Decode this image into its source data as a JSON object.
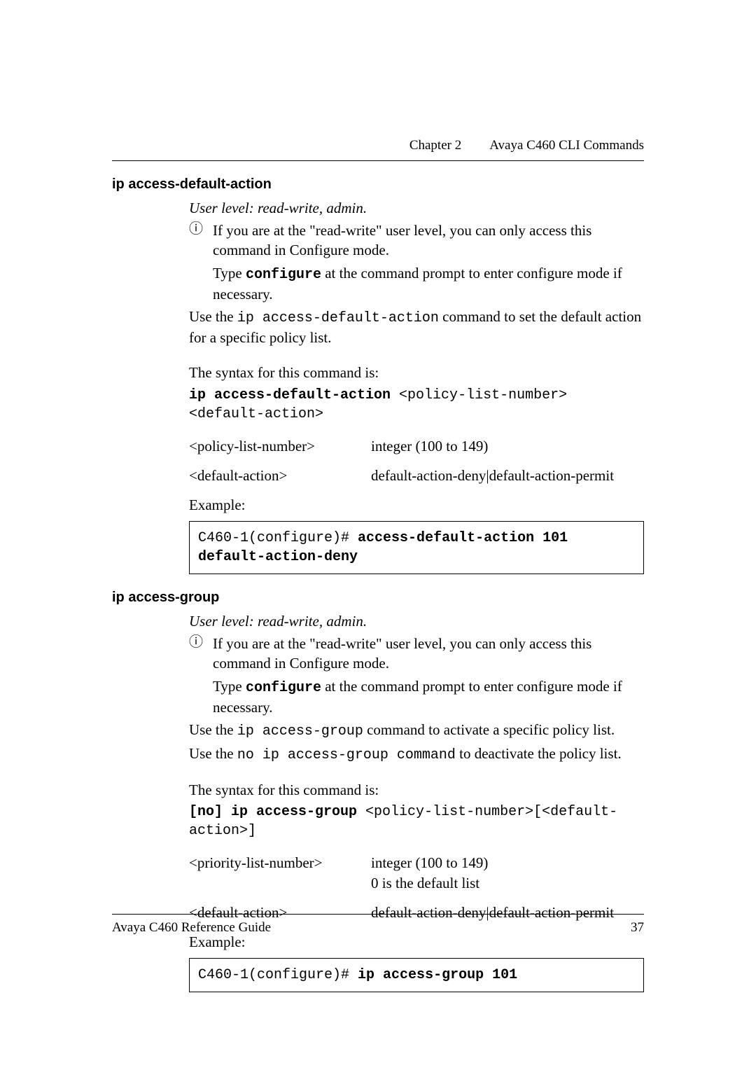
{
  "header": {
    "chapter": "Chapter 2",
    "title": "Avaya C460 CLI Commands"
  },
  "sections": [
    {
      "heading": "ip access-default-action",
      "user_level": "User level: read-write, admin.",
      "note": "If you are at the \"read-write\" user level, you can only access this command in Configure mode.",
      "note_line2_pre": "Type ",
      "note_line2_code": "configure",
      "note_line2_post": " at the command prompt to enter configure mode if necessary.",
      "desc_pre": "Use the ",
      "desc_code": "ip access-default-action",
      "desc_post": " command to set the default action for a specific policy list.",
      "syntax_label": "The syntax for this command is:",
      "syntax_cmd": "ip access-default-action",
      "syntax_args": " <policy-list-number> <default-action>",
      "params": [
        {
          "key": "<policy-list-number>",
          "val": "integer (100 to 149)"
        },
        {
          "key": "<default-action>",
          "val": "default-action-deny|default-action-permit"
        }
      ],
      "example_label": "Example:",
      "example_prefix": "C460-1(configure)# ",
      "example_cmd": "access-default-action 101 default-action-deny"
    },
    {
      "heading": "ip access-group",
      "user_level": "User level: read-write, admin.",
      "note": "If you are at the \"read-write\" user level, you can only access this command in Configure mode.",
      "note_line2_pre": "Type ",
      "note_line2_code": "configure",
      "note_line2_post": " at the command prompt to enter configure mode if necessary.",
      "desc_pre": "Use the ",
      "desc_code": "ip access-group",
      "desc_post": " command to activate a specific policy list.",
      "desc2_pre": "Use the ",
      "desc2_code": "no ip access-group command",
      "desc2_post": "  to deactivate the policy list.",
      "syntax_label": "The syntax for this command is:",
      "syntax_cmd": "[no] ip access-group",
      "syntax_args": " <policy-list-number>[<default-action>]",
      "params": [
        {
          "key": "<priority-list-number>",
          "val": "integer (100 to 149)\n0 is the default list"
        },
        {
          "key": "<default-action>",
          "val": "default-action-deny|default-action-permit"
        }
      ],
      "example_label": "Example:",
      "example_prefix": "C460-1(configure)# ",
      "example_cmd": "ip access-group 101"
    }
  ],
  "footer": {
    "left": "Avaya C460 Reference Guide",
    "right": "37"
  },
  "icons": {
    "info": "ⓘ"
  }
}
